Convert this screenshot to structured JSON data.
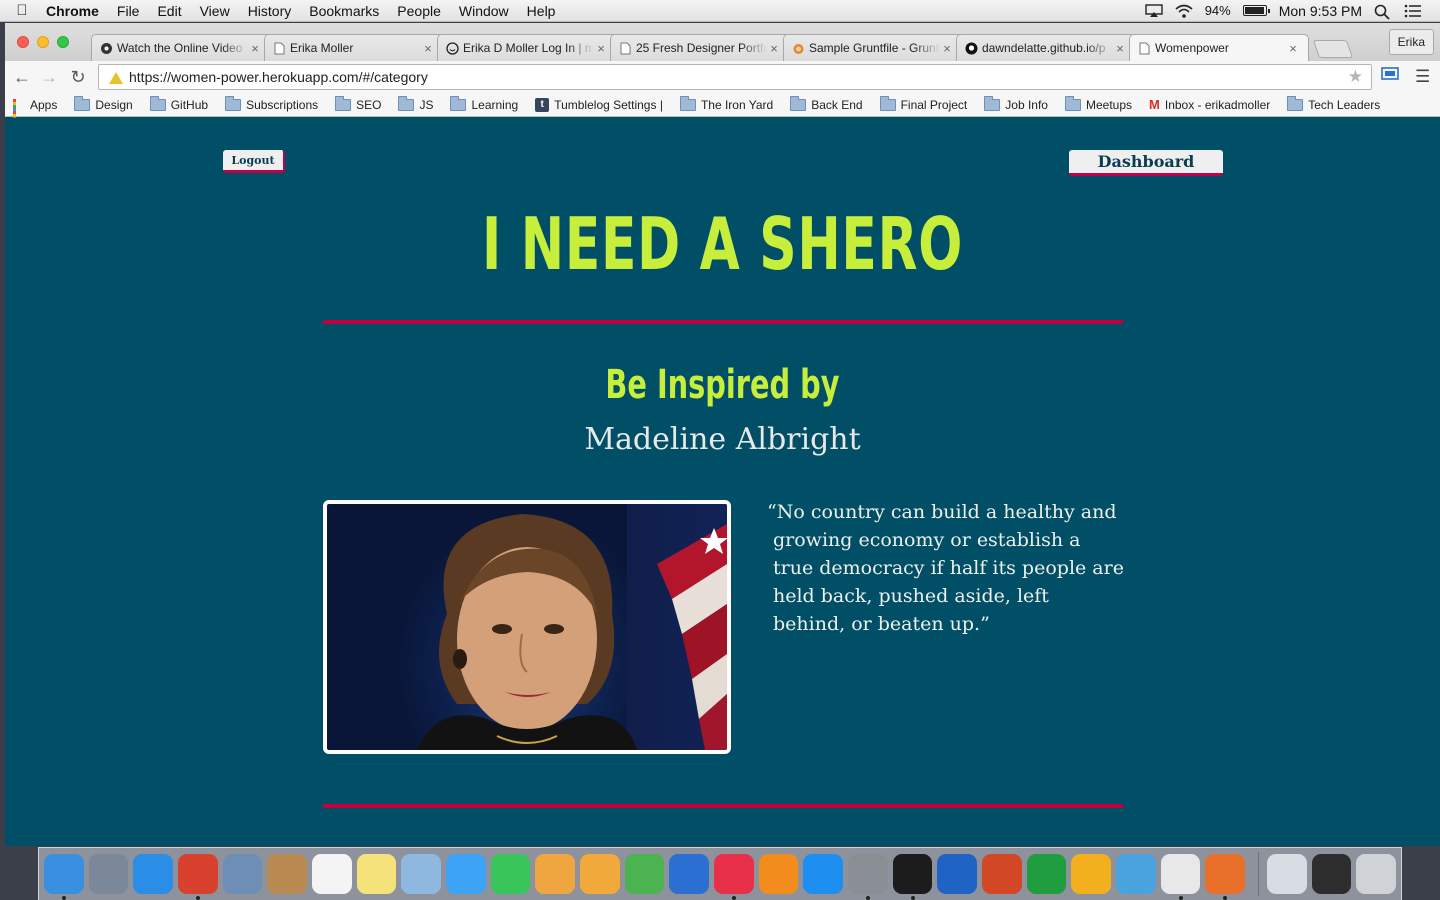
{
  "menubar": {
    "app_name": "Chrome",
    "items": [
      "File",
      "Edit",
      "View",
      "History",
      "Bookmarks",
      "People",
      "Window",
      "Help"
    ],
    "battery": "94%",
    "battery_level": 0.94,
    "clock": "Mon 9:53 PM"
  },
  "browser": {
    "tabs": [
      {
        "title": "Watch the Online Video",
        "icon": "video-favicon-icon"
      },
      {
        "title": "Erika Moller",
        "icon": "page-icon"
      },
      {
        "title": "Erika D Moller Log In | m",
        "icon": "smiley-favicon-icon"
      },
      {
        "title": "25 Fresh Designer Portfo",
        "icon": "page-icon"
      },
      {
        "title": "Sample Gruntfile - Grunt",
        "icon": "grunt-favicon-icon"
      },
      {
        "title": "dawndelatte.github.io/p",
        "icon": "github-icon"
      },
      {
        "title": "Womenpower",
        "icon": "page-icon"
      }
    ],
    "active_tab": 6,
    "profile": "Erika",
    "url": "https://women-power.herokuapp.com/#/category",
    "bookmarks": [
      {
        "label": "Apps",
        "icon": "apps-grid-icon"
      },
      {
        "label": "Design",
        "icon": "folder-icon"
      },
      {
        "label": "GitHub",
        "icon": "folder-icon"
      },
      {
        "label": "Subscriptions",
        "icon": "folder-icon"
      },
      {
        "label": "SEO",
        "icon": "folder-icon"
      },
      {
        "label": "JS",
        "icon": "folder-icon"
      },
      {
        "label": "Learning",
        "icon": "folder-icon"
      },
      {
        "label": "Tumblelog Settings |",
        "icon": "tumblr-icon"
      },
      {
        "label": "The Iron Yard",
        "icon": "folder-icon"
      },
      {
        "label": "Back End",
        "icon": "folder-icon"
      },
      {
        "label": "Final Project",
        "icon": "folder-icon"
      },
      {
        "label": "Job Info",
        "icon": "folder-icon"
      },
      {
        "label": "Meetups",
        "icon": "folder-icon"
      },
      {
        "label": "Inbox - erikadmoller",
        "icon": "gmail-icon"
      },
      {
        "label": "Tech Leaders",
        "icon": "folder-icon"
      }
    ]
  },
  "page": {
    "logout_label": "Logout",
    "dashboard_label": "Dashboard",
    "title": "I NEED A SHERO",
    "subtitle": "Be Inspired by",
    "name": "Madeline Albright",
    "quote": "“No country can build a healthy and growing economy or establish a true democracy if half its people are held back, pushed aside, left behind, or beaten up.”"
  },
  "colors": {
    "page_bg": "#004f66",
    "accent_lime": "#c8ee3c",
    "accent_red": "#c0003f",
    "button_bg": "#efefef"
  },
  "dock": [
    {
      "icon": "finder-icon",
      "color": "#3b8fe0"
    },
    {
      "icon": "launchpad-icon",
      "color": "#7a8899"
    },
    {
      "icon": "safari-icon",
      "color": "#2a8ee6"
    },
    {
      "icon": "chrome-icon",
      "color": "#d9412f"
    },
    {
      "icon": "mail-bird-icon",
      "color": "#6d8fb5"
    },
    {
      "icon": "contacts-icon",
      "color": "#b88a52"
    },
    {
      "icon": "calendar-icon",
      "color": "#f4f4f4"
    },
    {
      "icon": "notes-icon",
      "color": "#f6e27a"
    },
    {
      "icon": "preview-icon",
      "color": "#8fb8e0"
    },
    {
      "icon": "messages-icon",
      "color": "#3da3f5"
    },
    {
      "icon": "facetime-icon",
      "color": "#38c65a"
    },
    {
      "icon": "photos-icon",
      "color": "#f0a640"
    },
    {
      "icon": "pages-icon",
      "color": "#f2a93b"
    },
    {
      "icon": "numbers-icon",
      "color": "#4bb34f"
    },
    {
      "icon": "keynote-icon",
      "color": "#2a6fd1"
    },
    {
      "icon": "itunes-icon",
      "color": "#e8304a"
    },
    {
      "icon": "ibooks-icon",
      "color": "#f28c1c"
    },
    {
      "icon": "app-store-icon",
      "color": "#1e8ff0"
    },
    {
      "icon": "system-preferences-icon",
      "color": "#8a8f96"
    },
    {
      "icon": "terminal-icon",
      "color": "#1c1c1c"
    },
    {
      "icon": "word-icon",
      "color": "#1f63c4"
    },
    {
      "icon": "powerpoint-icon",
      "color": "#d24726"
    },
    {
      "icon": "excel-icon",
      "color": "#1f9d3f"
    },
    {
      "icon": "outlook-icon",
      "color": "#f2b01e"
    },
    {
      "icon": "network-globe-icon",
      "color": "#4aa3df"
    },
    {
      "icon": "slack-icon",
      "color": "#e8e8e8"
    },
    {
      "icon": "sublime-text-icon",
      "color": "#e8702a"
    },
    {
      "icon": "documents-icon",
      "color": "#d7dde2"
    },
    {
      "icon": "console-icon",
      "color": "#2d2d2d"
    },
    {
      "icon": "trash-icon",
      "color": "#cfd3d8"
    }
  ]
}
